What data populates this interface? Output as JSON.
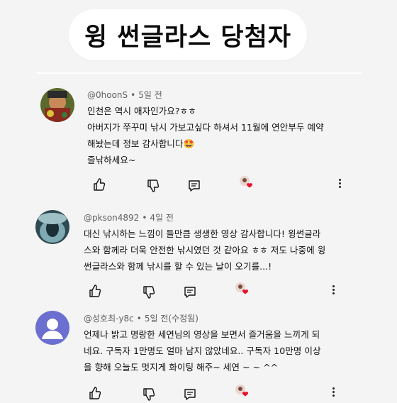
{
  "title": "윙 썬글라스 당첨자",
  "comments": [
    {
      "author": "@0hoonS",
      "time": "5일 전",
      "lines": [
        "인천은 역시 애자인가요?ㅎㅎ",
        "아버지가 쭈꾸미 낚시 가보고싶다 하셔서 11월에 연안부두 예약",
        "해놨는데 정보 감사합니다🤩",
        "즐낚하세요~"
      ]
    },
    {
      "author": "@pkson4892",
      "time": "4일 전",
      "lines": [
        "대신 낚시하는 느낌이 들만큼 생생한 영상 감사합니다! 윙썬글라",
        "스와 함께라 더욱 안전한 낚시였던 것 같아요 ㅎㅎ 저도 나중에 윙",
        "썬글라스와 함께 낚시를 할 수 있는 날이 오기를...!"
      ]
    },
    {
      "author": "@성호최-y8c",
      "time": "5일 전(수정됨)",
      "lines": [
        "언제나 밝고 명랑한 세연님의 영상을 보면서 즐거움을 느끼게 되",
        "네요. 구독자 1만명도 얼마 남지 않았네요.. 구독자 10만명 이상",
        "을 향해 오늘도 멋지게 화이팅 해주~ 세연 ~ ~ ^^"
      ]
    }
  ],
  "colors": {
    "background": "#f4f4f4",
    "meta_text": "#606060",
    "heart": "#e8112d",
    "default_avatar": "#6b6fcf"
  },
  "icons": [
    "like-icon",
    "dislike-icon",
    "reply-icon",
    "creator-heart-icon",
    "more-vert-icon"
  ]
}
